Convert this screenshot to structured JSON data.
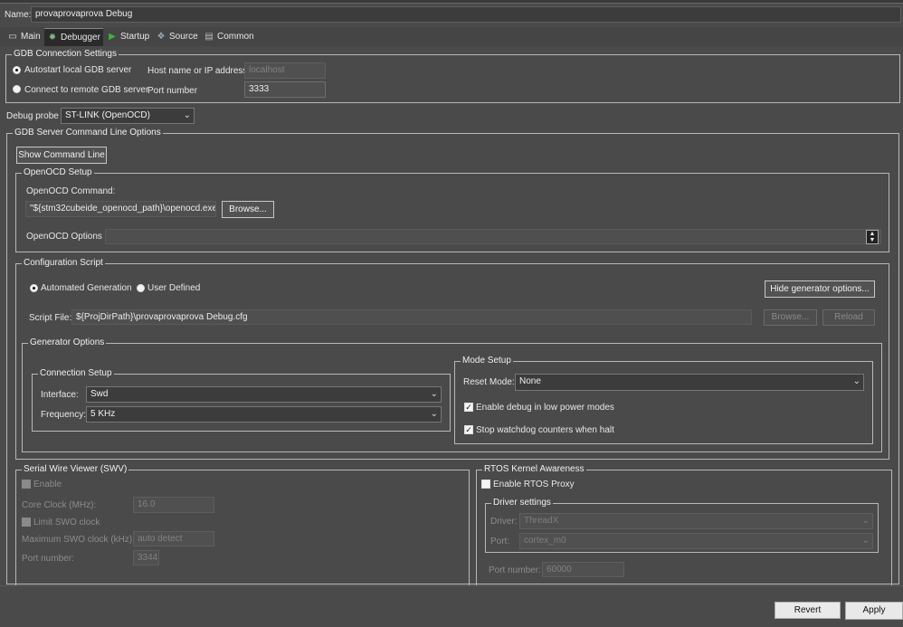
{
  "name_label": "Name:",
  "config_name": "provaprovaprova Debug",
  "tabs": [
    {
      "label": "Main",
      "icon": "document-icon"
    },
    {
      "label": "Debugger",
      "icon": "bug-icon"
    },
    {
      "label": "Startup",
      "icon": "play-icon"
    },
    {
      "label": "Source",
      "icon": "source-icon"
    },
    {
      "label": "Common",
      "icon": "common-icon"
    }
  ],
  "gdb": {
    "legend": "GDB Connection Settings",
    "autostart_label": "Autostart local GDB server",
    "remote_label": "Connect to remote GDB server",
    "host_label": "Host name or IP address",
    "host_value": "localhost",
    "port_label": "Port number",
    "port_value": "3333"
  },
  "probe": {
    "label": "Debug probe",
    "value": "ST-LINK (OpenOCD)"
  },
  "server": {
    "legend": "GDB Server Command Line Options",
    "show_cmd_button": "Show Command Line",
    "openocd_setup": {
      "legend": "OpenOCD Setup",
      "command_label": "OpenOCD Command:",
      "command_value": "\"${stm32cubeide_openocd_path}\\openocd.exe\"",
      "browse_button": "Browse...",
      "options_label": "OpenOCD Options :",
      "options_value": ""
    },
    "config_script": {
      "legend": "Configuration Script",
      "automated_label": "Automated Generation",
      "user_defined_label": "User Defined",
      "hide_gen_button": "Hide generator options...",
      "script_file_label": "Script File:",
      "script_file_value": "${ProjDirPath}\\provaprovaprova Debug.cfg",
      "browse_button": "Browse...",
      "reload_button": "Reload",
      "generator": {
        "legend": "Generator Options",
        "connection": {
          "legend": "Connection Setup",
          "interface_label": "Interface:",
          "interface_value": "Swd",
          "frequency_label": "Frequency:",
          "frequency_value": "5 KHz"
        },
        "mode": {
          "legend": "Mode Setup",
          "reset_label": "Reset Mode:",
          "reset_value": "None",
          "low_power_label": "Enable debug in low power modes",
          "watchdog_label": "Stop watchdog counters when halt"
        }
      }
    }
  },
  "swv": {
    "legend": "Serial Wire Viewer (SWV)",
    "enable_label": "Enable",
    "core_clock_label": "Core Clock (MHz):",
    "core_clock_value": "16.0",
    "limit_swo_label": "Limit SWO clock",
    "max_swo_label": "Maximum SWO clock (kHz):",
    "max_swo_value": "auto detect",
    "port_label": "Port number:",
    "port_value": "3344"
  },
  "rtos": {
    "legend": "RTOS Kernel Awareness",
    "enable_label": "Enable RTOS Proxy",
    "driver_settings": {
      "legend": "Driver settings",
      "driver_label": "Driver:",
      "driver_value": "ThreadX",
      "port_label": "Port:",
      "port_value": "cortex_m0"
    },
    "port_number_label": "Port number:",
    "port_number_value": "60000"
  },
  "footer": {
    "revert_button": "Revert",
    "apply_button": "Apply"
  }
}
